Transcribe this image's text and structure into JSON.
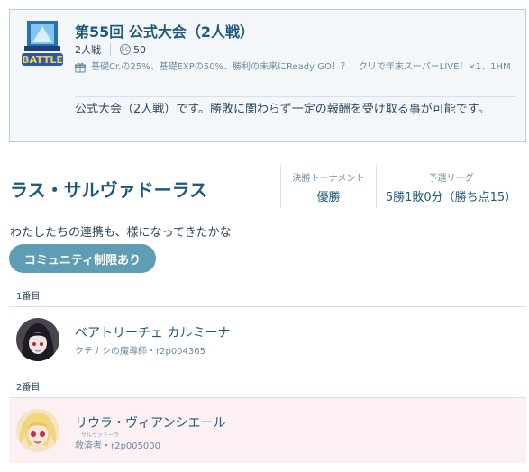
{
  "event": {
    "logo_text": "BATTLE",
    "title": "第55回 公式大会（2人戦）",
    "mode": "2人戦",
    "cost_icon": "EC",
    "cost": "50",
    "rewards": "基礎Cr.の25%、基礎EXPの50%、勝利の未来にReady GO！？　クリで年末スーパーLIVE！×1、1HM",
    "description": "公式大会（2人戦）です。勝敗に関わらず一定の報酬を受け取る事が可能です。"
  },
  "result": {
    "character_name": "ラス・サルヴァドーラス",
    "tournament_label": "決勝トーナメント",
    "tournament_value": "優勝",
    "league_label": "予選リーグ",
    "league_value": "5勝1敗0分（勝ち点15）"
  },
  "quote": "わたしたちの連携も、様になってきたかな",
  "community_button": "コミュニティ制限あり",
  "members": [
    {
      "order_label": "1番目",
      "name": "ベアトリーチェ カルミーナ",
      "sub": "クチナシの魔導師・r2p004365"
    },
    {
      "order_label": "2番目",
      "name": "リウラ・ヴィアンシエール",
      "ruby": "サルヴァドーラ",
      "sub": "救済者・r2p005000"
    }
  ],
  "colors": {
    "accent": "#1e5a7c",
    "button": "#5e9db4",
    "card_bg": "#f3f7fa",
    "highlight_row": "#fdf0f2"
  }
}
